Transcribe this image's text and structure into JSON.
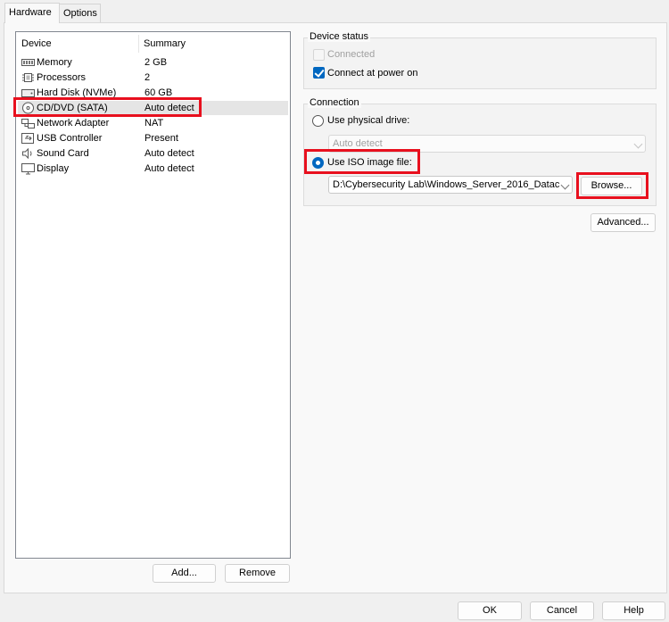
{
  "tabs": [
    {
      "label": "Hardware",
      "active": true
    },
    {
      "label": "Options",
      "active": false
    }
  ],
  "device_list": {
    "columns": {
      "device": "Device",
      "summary": "Summary"
    },
    "rows": [
      {
        "name": "Memory",
        "summary": "2 GB",
        "icon": "memory-icon"
      },
      {
        "name": "Processors",
        "summary": "2",
        "icon": "processor-icon"
      },
      {
        "name": "Hard Disk (NVMe)",
        "summary": "60 GB",
        "icon": "hard-disk-icon"
      },
      {
        "name": "CD/DVD (SATA)",
        "summary": "Auto detect",
        "icon": "cd-dvd-icon",
        "selected": true
      },
      {
        "name": "Network Adapter",
        "summary": "NAT",
        "icon": "network-adapter-icon"
      },
      {
        "name": "USB Controller",
        "summary": "Present",
        "icon": "usb-controller-icon"
      },
      {
        "name": "Sound Card",
        "summary": "Auto detect",
        "icon": "sound-card-icon"
      },
      {
        "name": "Display",
        "summary": "Auto detect",
        "icon": "display-icon"
      }
    ],
    "add_label": "Add...",
    "remove_label": "Remove"
  },
  "device_status": {
    "title": "Device status",
    "connected_label": "Connected",
    "connected_checked": false,
    "connect_at_power_on_label": "Connect at power on",
    "connect_at_power_on_checked": true
  },
  "connection": {
    "title": "Connection",
    "physical_drive_label": "Use physical drive:",
    "physical_drive_value": "Auto detect",
    "iso_label": "Use ISO image file:",
    "iso_selected": true,
    "iso_path": "D:\\Cybersecurity Lab\\Windows_Server_2016_Datac",
    "browse_label": "Browse..."
  },
  "advanced_label": "Advanced...",
  "footer": {
    "ok_label": "OK",
    "cancel_label": "Cancel",
    "help_label": "Help"
  },
  "colors": {
    "accent": "#0067c0",
    "highlight": "#e8101e",
    "selected_row": "#e5e5e5"
  }
}
